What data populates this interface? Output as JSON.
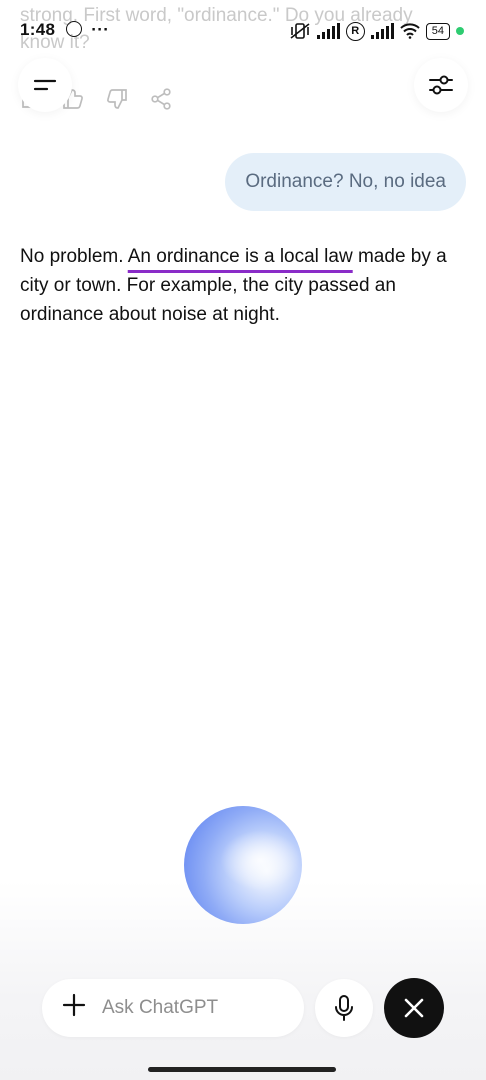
{
  "status_bar": {
    "time": "1:48",
    "dots": "···",
    "battery": "54",
    "roaming": "R"
  },
  "previous_message": {
    "text": "strong. First word, \"ordinance.\" Do you already know it?"
  },
  "header": {
    "menu_icon": "menu-icon",
    "settings_icon": "sliders-icon"
  },
  "user_message": {
    "text": "Ordinance? No, no idea"
  },
  "assistant_message": {
    "before": "No problem. ",
    "highlight": "An ordinance is a local law",
    "after": " made by a city or town. For example, the city passed an ordinance about noise at night."
  },
  "composer": {
    "placeholder": "Ask ChatGPT"
  },
  "colors": {
    "user_bubble": "#e4eff9",
    "highlight_underline": "#8a2cc8",
    "close_button": "#111111"
  }
}
